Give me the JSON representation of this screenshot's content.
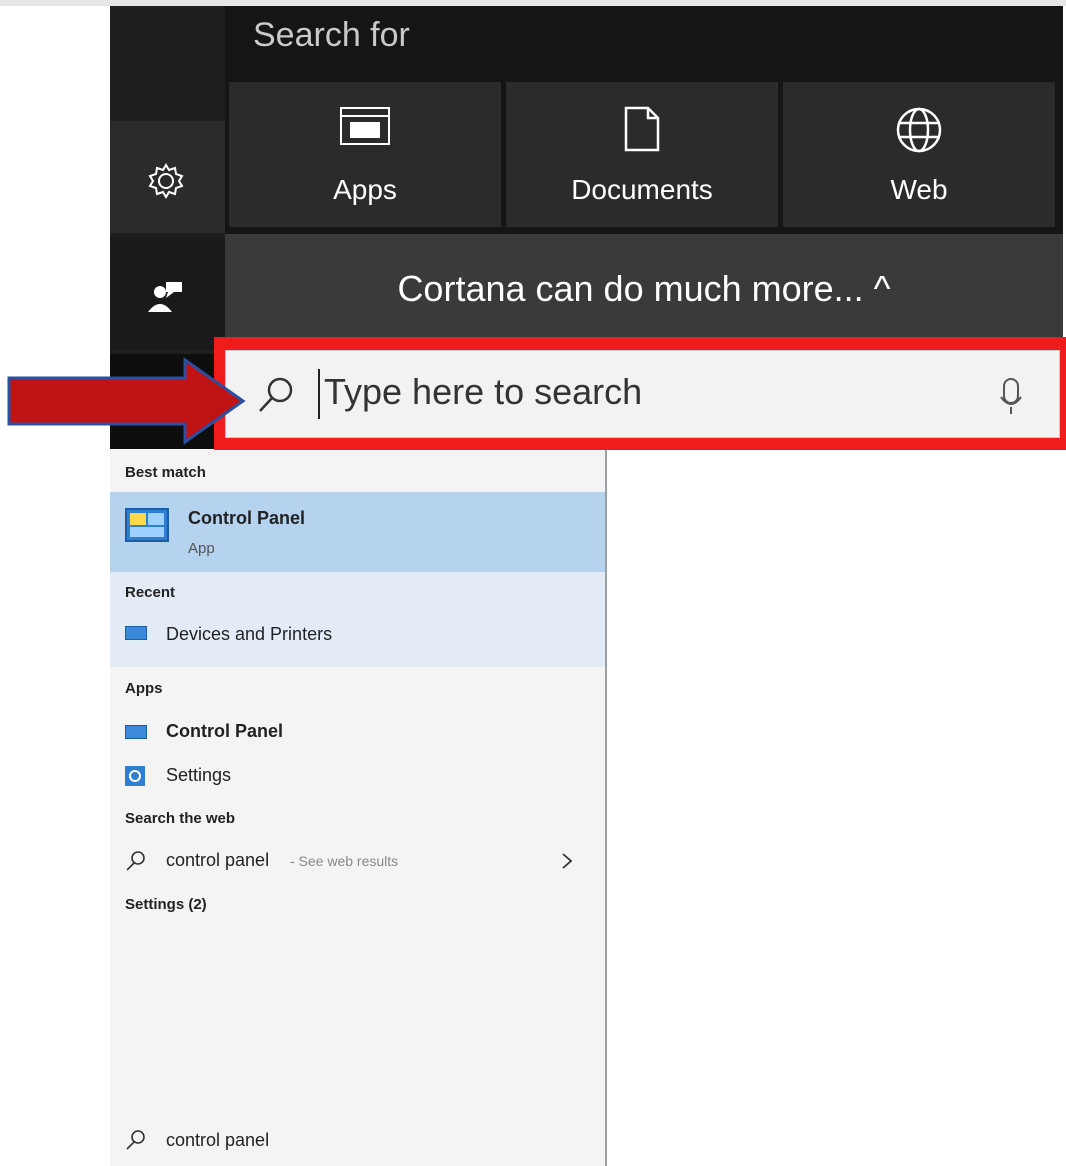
{
  "top_panel": {
    "search_for_label": "Search for",
    "tiles": [
      {
        "label": "Apps",
        "icon": "apps-icon"
      },
      {
        "label": "Documents",
        "icon": "document-icon"
      },
      {
        "label": "Web",
        "icon": "globe-icon"
      }
    ],
    "cortana_label": "Cortana can do much more... ^"
  },
  "left_rail": {
    "items": [
      {
        "icon": "gear-icon"
      },
      {
        "icon": "feedback-icon"
      }
    ]
  },
  "search": {
    "placeholder": "Type here to search"
  },
  "results": {
    "best_match_label": "Best match",
    "best_match": {
      "title": "Control Panel",
      "subtitle": "App"
    },
    "recent_label": "Recent",
    "recent": [
      {
        "label": "Devices and Printers"
      }
    ],
    "apps_label": "Apps",
    "apps": [
      {
        "label": "Control Panel"
      },
      {
        "label": "Settings"
      }
    ],
    "web_label": "Search the web",
    "web_query": "control panel",
    "web_suffix": " - See web results",
    "settings_label": "Settings (2)"
  },
  "bottom_search": {
    "value": "control panel"
  },
  "colors": {
    "highlight_red": "#ee1c1c",
    "arrow_red": "#c01414",
    "arrow_border": "#2b4fa3",
    "best_match_bg": "#b5d3ee",
    "recent_bg": "#e3ecf6"
  }
}
